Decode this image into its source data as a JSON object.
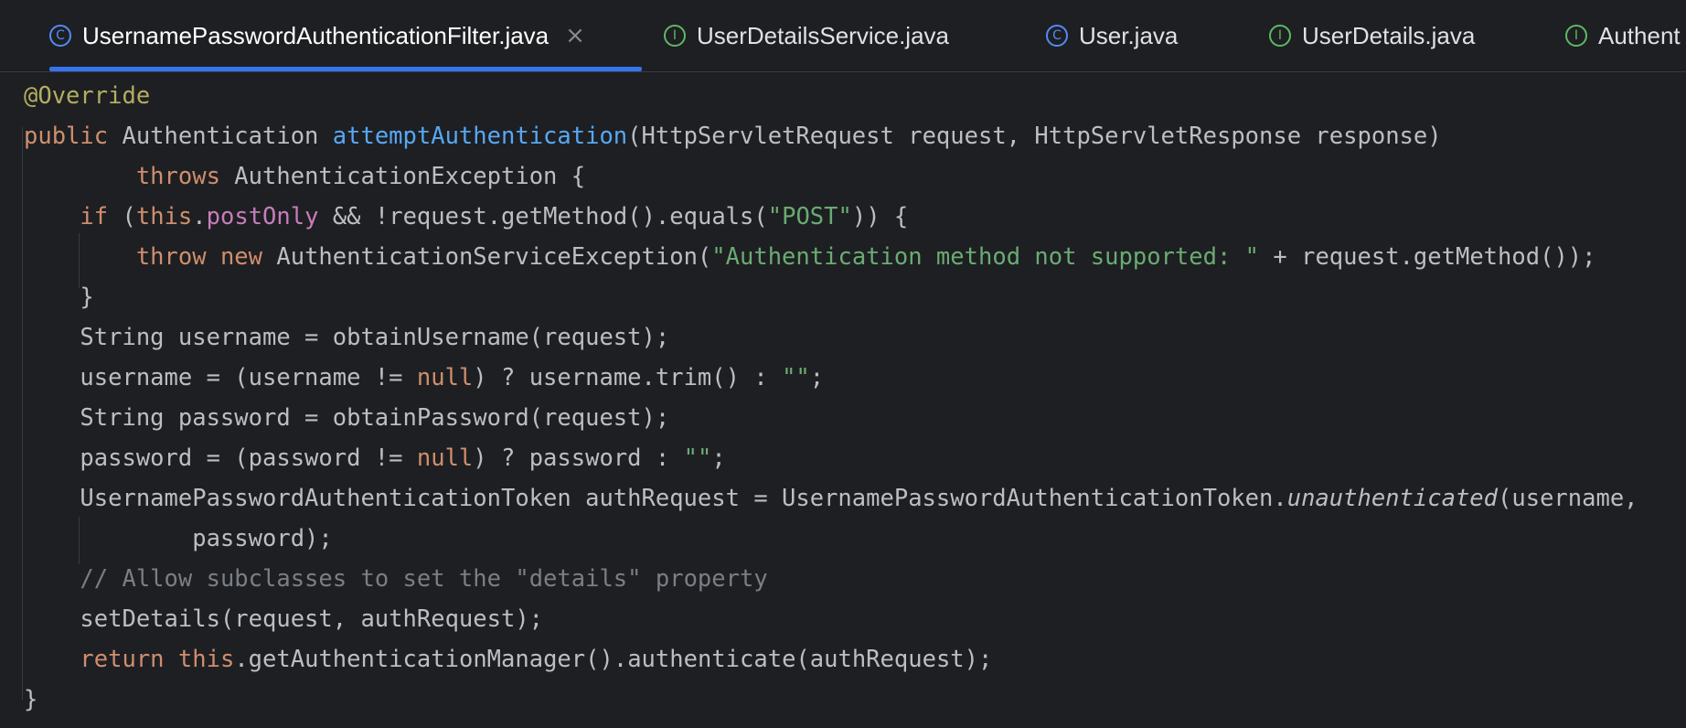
{
  "tabs": [
    {
      "label": "UsernamePasswordAuthenticationFilter.java",
      "icon": "class-icon",
      "glyph": "C",
      "active": true,
      "close": "×"
    },
    {
      "label": "UserDetailsService.java",
      "icon": "interface-icon",
      "glyph": "I",
      "active": false
    },
    {
      "label": "User.java",
      "icon": "class-icon",
      "glyph": "C",
      "active": false
    },
    {
      "label": "UserDetails.java",
      "icon": "interface-icon",
      "glyph": "I",
      "active": false
    },
    {
      "label": "Authent",
      "icon": "interface-icon",
      "glyph": "I",
      "active": false
    }
  ],
  "colors": {
    "background": "#1e1f22",
    "accent": "#3574f0",
    "keyword": "#cf8e6d",
    "annotation": "#b3ae60",
    "method_decl": "#56a8f5",
    "field": "#c77dbb",
    "string": "#6aab73",
    "comment": "#7a7e85",
    "text": "#bcbec4"
  },
  "code": {
    "lines": [
      [
        {
          "t": "@Override",
          "c": "ann"
        }
      ],
      [
        {
          "t": "public",
          "c": "kw"
        },
        {
          "t": " Authentication "
        },
        {
          "t": "attemptAuthentication",
          "c": "fn"
        },
        {
          "t": "(HttpServletRequest request, HttpServletResponse response)"
        }
      ],
      [
        {
          "t": "        "
        },
        {
          "t": "throws",
          "c": "kw"
        },
        {
          "t": " AuthenticationException {"
        }
      ],
      [
        {
          "t": "    "
        },
        {
          "t": "if",
          "c": "kw"
        },
        {
          "t": " ("
        },
        {
          "t": "this",
          "c": "kw"
        },
        {
          "t": "."
        },
        {
          "t": "postOnly",
          "c": "fld"
        },
        {
          "t": " && !request.getMethod().equals("
        },
        {
          "t": "\"POST\"",
          "c": "str"
        },
        {
          "t": ")) {"
        }
      ],
      [
        {
          "t": "        "
        },
        {
          "t": "throw",
          "c": "kw"
        },
        {
          "t": " "
        },
        {
          "t": "new",
          "c": "kw"
        },
        {
          "t": " AuthenticationServiceException("
        },
        {
          "t": "\"Authentication method not supported: \"",
          "c": "str"
        },
        {
          "t": " + request.getMethod());"
        }
      ],
      [
        {
          "t": "    }"
        }
      ],
      [
        {
          "t": "    String username = obtainUsername(request);"
        }
      ],
      [
        {
          "t": "    username = (username != "
        },
        {
          "t": "null",
          "c": "kw"
        },
        {
          "t": ") ? username.trim() : "
        },
        {
          "t": "\"\"",
          "c": "str"
        },
        {
          "t": ";"
        }
      ],
      [
        {
          "t": "    String password = obtainPassword(request);"
        }
      ],
      [
        {
          "t": "    password = (password != "
        },
        {
          "t": "null",
          "c": "kw"
        },
        {
          "t": ") ? password : "
        },
        {
          "t": "\"\"",
          "c": "str"
        },
        {
          "t": ";"
        }
      ],
      [
        {
          "t": "    UsernamePasswordAuthenticationToken authRequest = UsernamePasswordAuthenticationToken."
        },
        {
          "t": "unauthenticated",
          "c": "it"
        },
        {
          "t": "(username,"
        }
      ],
      [
        {
          "t": "            password);"
        }
      ],
      [
        {
          "t": "    "
        },
        {
          "t": "// Allow subclasses to set the \"details\" property",
          "c": "cmt"
        }
      ],
      [
        {
          "t": "    setDetails(request, authRequest);"
        }
      ],
      [
        {
          "t": "    "
        },
        {
          "t": "return",
          "c": "kw"
        },
        {
          "t": " "
        },
        {
          "t": "this",
          "c": "kw"
        },
        {
          "t": ".getAuthenticationManager().authenticate(authRequest);"
        }
      ],
      [
        {
          "t": "}"
        }
      ]
    ]
  }
}
